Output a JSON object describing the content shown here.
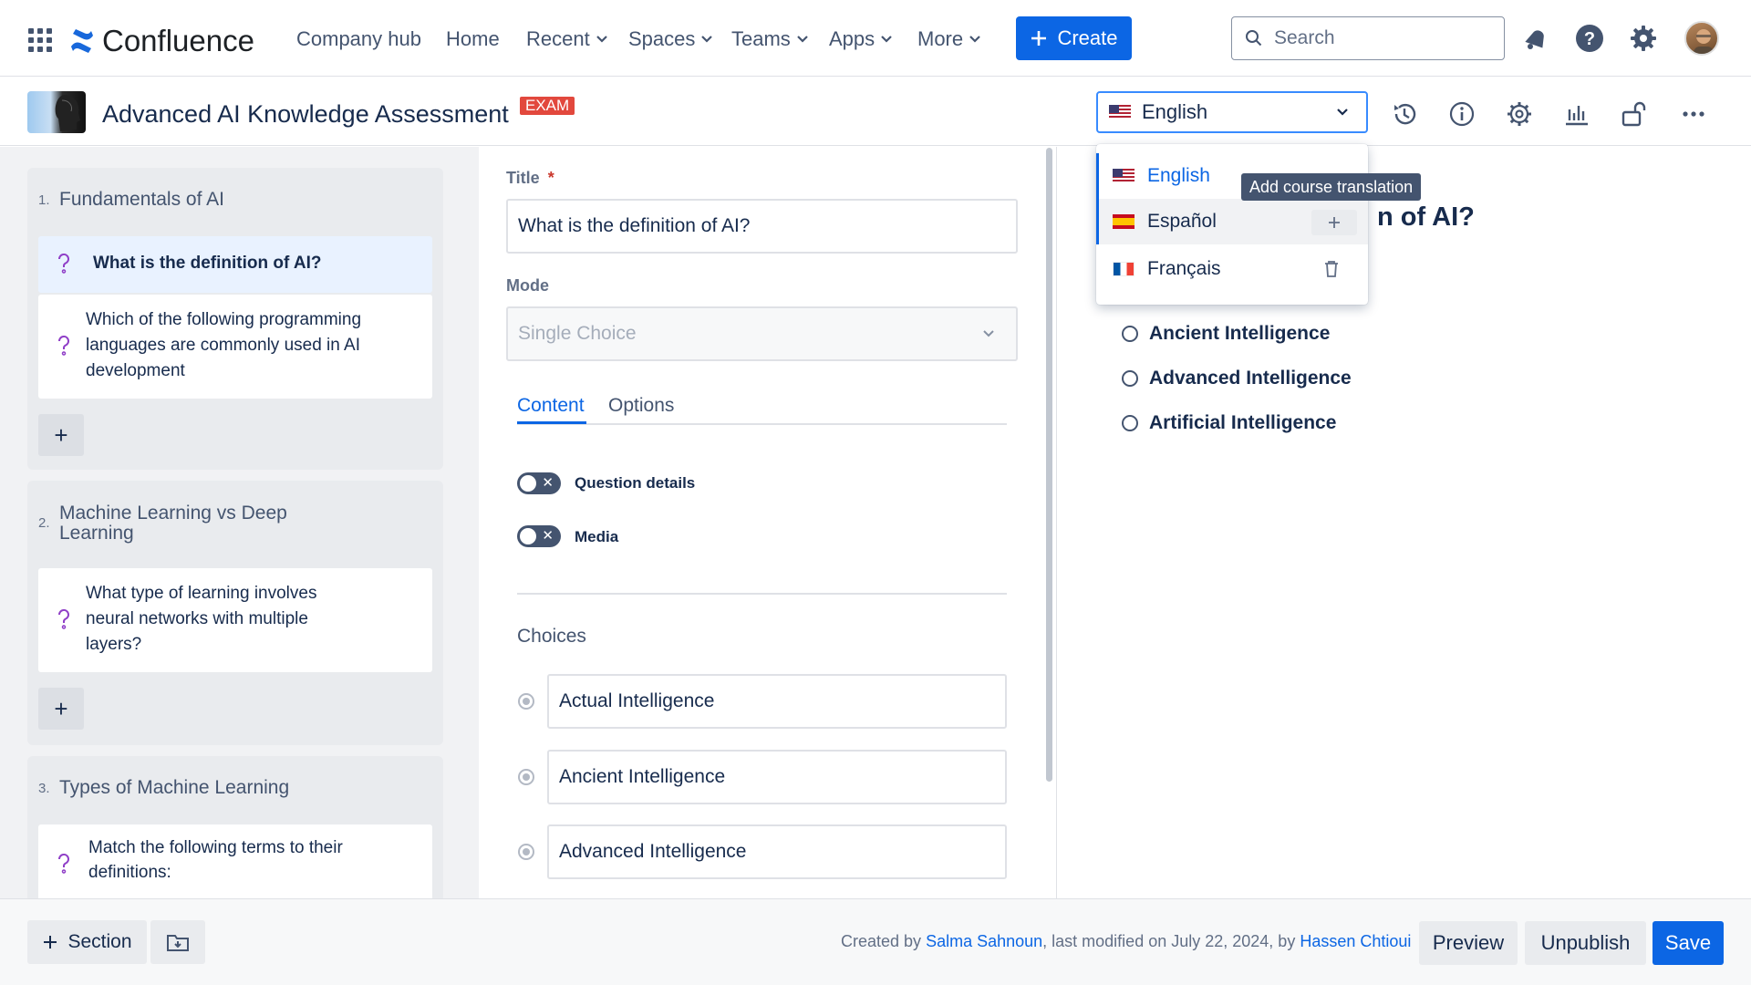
{
  "topnav": {
    "app_name": "Confluence",
    "links": [
      "Company hub",
      "Home",
      "Recent",
      "Spaces",
      "Teams",
      "Apps",
      "More"
    ],
    "create_label": "Create",
    "search_placeholder": "Search",
    "icons": [
      "apps-grid-icon",
      "notifications-icon",
      "help-icon",
      "settings-icon",
      "avatar"
    ]
  },
  "page": {
    "title": "Advanced AI Knowledge Assessment",
    "badge": "EXAM",
    "language": "English",
    "header_icons": [
      "history-icon",
      "info-icon",
      "settings-icon",
      "analytics-icon",
      "unlock-icon",
      "more-icon"
    ]
  },
  "sidebar": {
    "sections": [
      {
        "number": "1.",
        "title": "Fundamentals of AI",
        "questions": [
          {
            "text": "What is the definition of AI?",
            "active": true
          },
          {
            "text": "Which of the following programming languages are commonly used in AI development",
            "active": false
          }
        ]
      },
      {
        "number": "2.",
        "title": "Machine Learning vs Deep Learning",
        "questions": [
          {
            "text": "What type of learning involves neural networks with multiple layers?",
            "active": false
          }
        ]
      },
      {
        "number": "3.",
        "title": "Types of Machine Learning",
        "questions": [
          {
            "text": "Match the following terms to their definitions:",
            "active": false
          }
        ]
      }
    ],
    "add_label": "+"
  },
  "editor": {
    "title_label": "Title",
    "required_mark": "*",
    "title_value": "What is the definition of AI?",
    "mode_label": "Mode",
    "mode_placeholder": "Single Choice",
    "tabs": [
      "Content",
      "Options"
    ],
    "active_tab": "Content",
    "toggles": [
      {
        "label": "Question details",
        "on": false
      },
      {
        "label": "Media",
        "on": false
      }
    ],
    "choices_label": "Choices",
    "choices": [
      "Actual Intelligence",
      "Ancient Intelligence",
      "Advanced Intelligence"
    ]
  },
  "preview": {
    "title_fragment": "n of AI?",
    "options": [
      "Ancient Intelligence",
      "Advanced Intelligence",
      "Artificial Intelligence"
    ]
  },
  "language_menu": {
    "options": [
      {
        "label": "English",
        "flag": "us",
        "selected": true
      },
      {
        "label": "Español",
        "flag": "es",
        "action": "add"
      },
      {
        "label": "Français",
        "flag": "fr",
        "action": "delete"
      }
    ],
    "tooltip": "Add course translation"
  },
  "footer": {
    "section_label": "Section",
    "meta_prefix": "Created by ",
    "creator": "Salma Sahnoun",
    "meta_middle": ", last modified on July 22, 2024, by ",
    "modifier": "Hassen Chtioui",
    "preview_label": "Preview",
    "unpublish_label": "Unpublish",
    "save_label": "Save"
  },
  "colors": {
    "primary": "#0c66e4",
    "badge": "#e2483d",
    "question_icon": "#8f3ec7"
  }
}
